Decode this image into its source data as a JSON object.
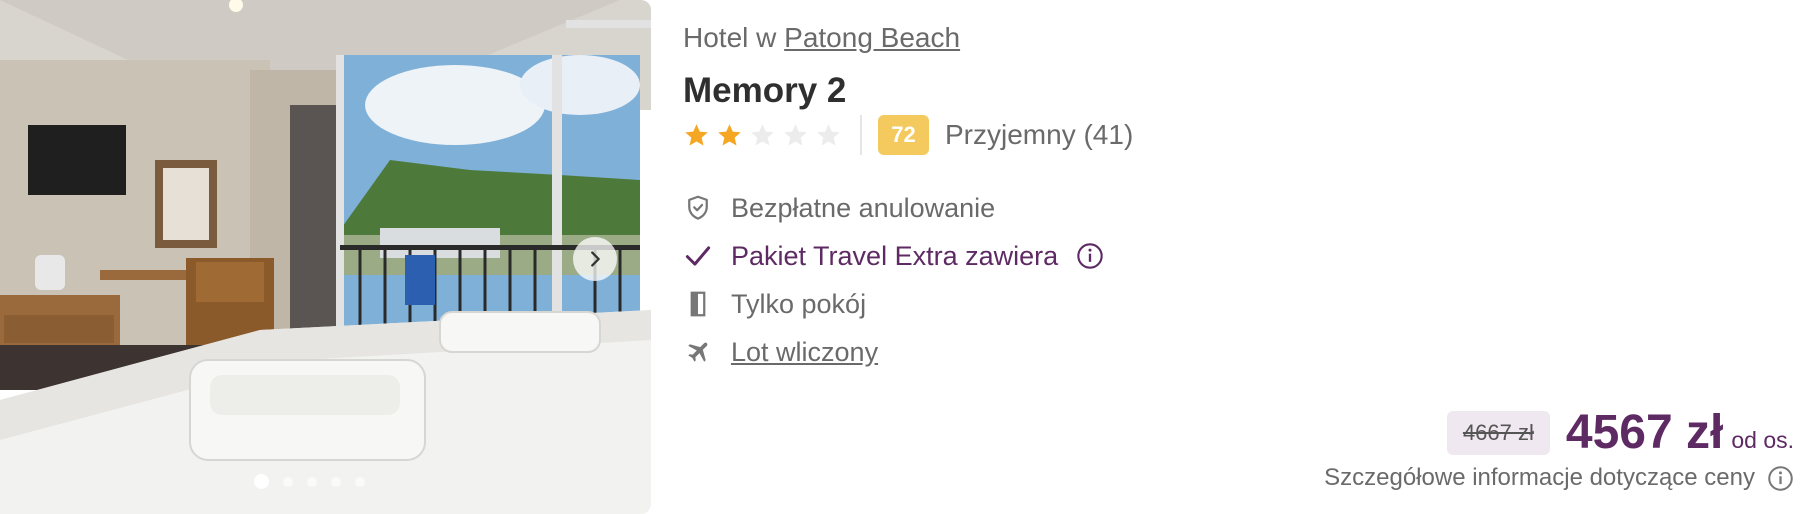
{
  "photo": {
    "alt": "Hotel room with balcony and mountain view",
    "dots_count": 5,
    "active_dot": 0,
    "next_icon": "chevron-right-icon"
  },
  "hotel": {
    "location_prefix": "Hotel w",
    "location_link": "Patong Beach",
    "name": "Memory 2",
    "stars": 2,
    "stars_max": 5,
    "score": "72",
    "score_text": "Przyjemny (41)"
  },
  "features": {
    "free_cancel": "Bezpłatne anulowanie",
    "travel_extra": "Pakiet Travel Extra zawiera",
    "room_only": "Tylko pokój",
    "flight": "Lot wliczony"
  },
  "price": {
    "old": "4667 zł",
    "new": "4567 zł",
    "per_person": "od os.",
    "details": "Szczegółowe informacje dotyczące ceny"
  },
  "colors": {
    "accent": "#5e2a63",
    "star": "#f5a623",
    "score_badge": "#f4c95d",
    "text_muted": "#6a6a6a"
  }
}
